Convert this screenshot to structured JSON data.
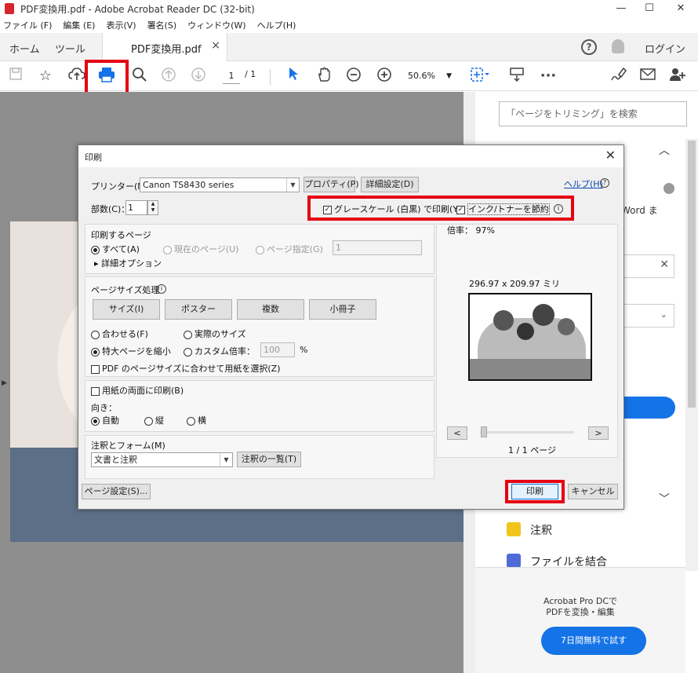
{
  "window": {
    "title": "PDF変換用.pdf - Adobe Acrobat Reader DC (32-bit)",
    "minimize": "—",
    "maximize": "☐",
    "close": "✕"
  },
  "menu": {
    "items": [
      "ファイル (F)",
      "編集 (E)",
      "表示(V)",
      "署名(S)",
      "ウィンドウ(W)",
      "ヘルプ(H)"
    ]
  },
  "tabs": {
    "home": "ホーム",
    "tools": "ツール",
    "document": "PDF変換用.pdf",
    "close": "×",
    "help": "?",
    "login": "ログイン"
  },
  "toolbar": {
    "page_current": "1",
    "page_total": "/ 1",
    "zoom": "50.6%"
  },
  "right_panel": {
    "search_placeholder": "「ページをトリミング」を検索",
    "partial_text": "Word ま",
    "comment": "注釈",
    "combine": "ファイルを結合",
    "promo_line1": "Acrobat Pro DCで",
    "promo_line2": "PDFを変換・編集",
    "trial_button": "7日間無料で試す"
  },
  "dialog": {
    "title": "印刷",
    "close": "✕",
    "printer_label": "プリンター(N)：",
    "printer_value": "Canon TS8430 series",
    "properties_button": "プロパティ(P)",
    "advanced_button": "詳細設定(D)",
    "help_link": "ヘルプ(H)",
    "copies_label": "部数(C)：",
    "copies_value": "1",
    "grayscale_label": "グレースケール (白黒) で印刷(Y)",
    "save_ink_label": "インク/トナーを節約",
    "pages_section": {
      "title": "印刷するページ",
      "all": "すべて(A)",
      "current": "現在のページ(U)",
      "specify": "ページ指定(G)",
      "range_value": "1",
      "more_options": "▸ 詳細オプション"
    },
    "size_section": {
      "title": "ページサイズ処理",
      "size_button": "サイズ(I)",
      "poster_button": "ポスター",
      "multiple_button": "複数",
      "booklet_button": "小冊子",
      "fit": "合わせる(F)",
      "actual": "実際のサイズ",
      "shrink": "特大ページを縮小",
      "custom": "カスタム倍率：",
      "custom_value": "100",
      "percent": "%",
      "choose_paper": "PDF のページサイズに合わせて用紙を選択(Z)"
    },
    "duplex": "用紙の両面に印刷(B)",
    "orientation": {
      "title": "向き：",
      "auto": "自動",
      "portrait": "縦",
      "landscape": "横"
    },
    "comments": {
      "title": "注釈とフォーム(M)",
      "value": "文書と注釈",
      "summary_button": "注釈の一覧(T)"
    },
    "preview": {
      "scale": "倍率： 97%",
      "size": "296.97 x 209.97 ミリ",
      "prev": "<",
      "next": ">",
      "page_count": "1 / 1 ページ"
    },
    "page_setup_button": "ページ設定(S)...",
    "print_button": "印刷",
    "cancel_button": "キャンセル"
  }
}
